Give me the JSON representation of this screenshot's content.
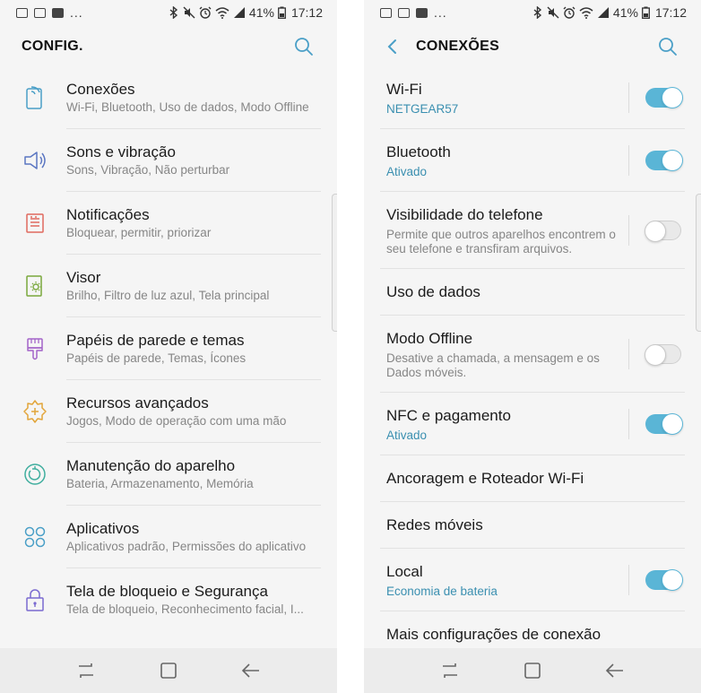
{
  "status_bar": {
    "dots": "...",
    "battery_percent": "41%",
    "time": "17:12"
  },
  "left_screen": {
    "title": "CONFIG.",
    "items": [
      {
        "title": "Conexões",
        "subtitle": "Wi-Fi, Bluetooth, Uso de dados, Modo Offline",
        "icon": "connections-icon",
        "color": "#4a9fc7"
      },
      {
        "title": "Sons e vibração",
        "subtitle": "Sons, Vibração, Não perturbar",
        "icon": "speaker-icon",
        "color": "#5b76c2"
      },
      {
        "title": "Notificações",
        "subtitle": "Bloquear, permitir, priorizar",
        "icon": "notifications-icon",
        "color": "#e06a5e"
      },
      {
        "title": "Visor",
        "subtitle": "Brilho, Filtro de luz azul, Tela principal",
        "icon": "display-icon",
        "color": "#7aa83c"
      },
      {
        "title": "Papéis de parede e temas",
        "subtitle": "Papéis de parede, Temas, Ícones",
        "icon": "brush-icon",
        "color": "#a365c9"
      },
      {
        "title": "Recursos avançados",
        "subtitle": "Jogos, Modo de operação com uma mão",
        "icon": "gear-plus-icon",
        "color": "#e2a53a"
      },
      {
        "title": "Manutenção do aparelho",
        "subtitle": "Bateria, Armazenamento, Memória",
        "icon": "maintenance-icon",
        "color": "#3fae9e"
      },
      {
        "title": "Aplicativos",
        "subtitle": "Aplicativos padrão, Permissões do aplicativo",
        "icon": "apps-icon",
        "color": "#4a9fc7"
      },
      {
        "title": "Tela de bloqueio e Segurança",
        "subtitle": "Tela de bloqueio, Reconhecimento facial, I...",
        "icon": "lock-icon",
        "color": "#7a6ad0"
      }
    ]
  },
  "right_screen": {
    "title": "CONEXÕES",
    "items": [
      {
        "title": "Wi-Fi",
        "subtitle": "NETGEAR57",
        "subtitle_accent": true,
        "toggle": "on",
        "height": "h70"
      },
      {
        "title": "Bluetooth",
        "subtitle": "Ativado",
        "subtitle_accent": true,
        "toggle": "on",
        "height": "h70"
      },
      {
        "title": "Visibilidade do telefone",
        "subtitle": "Permite que outros aparelhos encontrem o seu telefone e transfiram arquivos.",
        "subtitle_accent": false,
        "toggle": "off",
        "height": "h86"
      },
      {
        "title": "Uso de dados",
        "subtitle": "",
        "subtitle_accent": false,
        "toggle": "",
        "height": "h52"
      },
      {
        "title": "Modo Offline",
        "subtitle": "Desative a chamada, a mensagem e os Dados móveis.",
        "subtitle_accent": false,
        "toggle": "off",
        "height": "h86"
      },
      {
        "title": "NFC e pagamento",
        "subtitle": "Ativado",
        "subtitle_accent": true,
        "toggle": "on",
        "height": "h70"
      },
      {
        "title": "Ancoragem e Roteador Wi-Fi",
        "subtitle": "",
        "subtitle_accent": false,
        "toggle": "",
        "height": "h52"
      },
      {
        "title": "Redes móveis",
        "subtitle": "",
        "subtitle_accent": false,
        "toggle": "",
        "height": "h52"
      },
      {
        "title": "Local",
        "subtitle": "Economia de bateria",
        "subtitle_accent": true,
        "toggle": "on",
        "height": "h70"
      },
      {
        "title": "Mais configurações de conexão",
        "subtitle": "",
        "subtitle_accent": false,
        "toggle": "",
        "height": "h52"
      }
    ]
  },
  "colors": {
    "accent": "#3a8fb0",
    "toggle_on": "#5ab5d6"
  }
}
